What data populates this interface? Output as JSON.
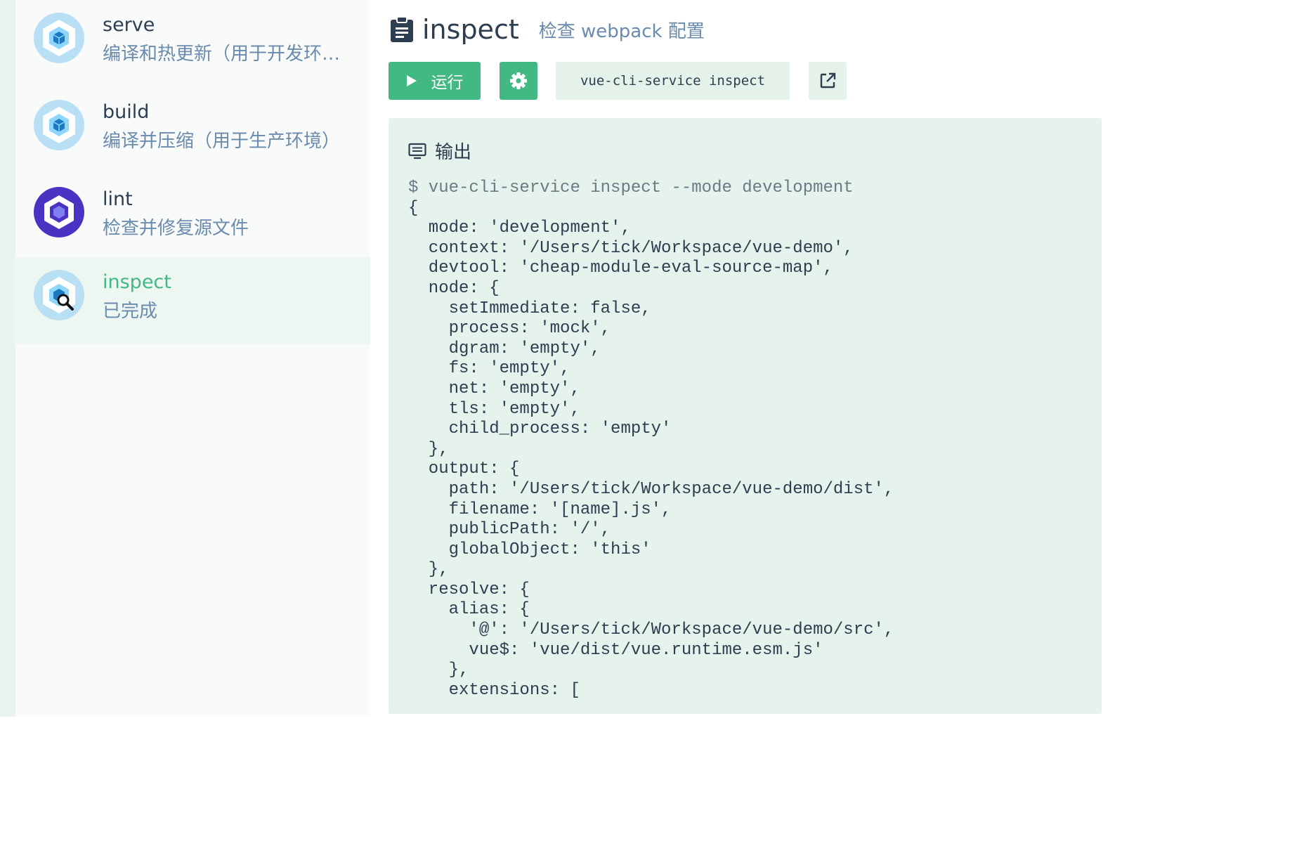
{
  "sidebar": {
    "tasks": [
      {
        "name": "serve",
        "description": "编译和热更新（用于开发环境）",
        "icon": "webpack-cube-icon"
      },
      {
        "name": "build",
        "description": "编译并压缩（用于生产环境）",
        "icon": "webpack-cube-icon"
      },
      {
        "name": "lint",
        "description": "检查并修复源文件",
        "icon": "eslint-icon"
      },
      {
        "name": "inspect",
        "description": "已完成",
        "icon": "webpack-inspect-icon",
        "selected": true
      }
    ]
  },
  "header": {
    "title": "inspect",
    "subtitle": "检查 webpack 配置"
  },
  "toolbar": {
    "run_label": "运行",
    "command": "vue-cli-service inspect"
  },
  "output": {
    "title": "输出",
    "command_line": "$ vue-cli-service inspect --mode development",
    "lines": [
      "{",
      "  mode: 'development',",
      "  context: '/Users/tick/Workspace/vue-demo',",
      "  devtool: 'cheap-module-eval-source-map',",
      "  node: {",
      "    setImmediate: false,",
      "    process: 'mock',",
      "    dgram: 'empty',",
      "    fs: 'empty',",
      "    net: 'empty',",
      "    tls: 'empty',",
      "    child_process: 'empty'",
      "  },",
      "  output: {",
      "    path: '/Users/tick/Workspace/vue-demo/dist',",
      "    filename: '[name].js',",
      "    publicPath: '/',",
      "    globalObject: 'this'",
      "  },",
      "  resolve: {",
      "    alias: {",
      "      '@': '/Users/tick/Workspace/vue-demo/src',",
      "      vue$: 'vue/dist/vue.runtime.esm.js'",
      "    },",
      "    extensions: ["
    ]
  },
  "colors": {
    "accent": "#42b983",
    "text": "#2c3e50",
    "muted": "#6a8bad",
    "output_bg": "#e6f3ed"
  }
}
